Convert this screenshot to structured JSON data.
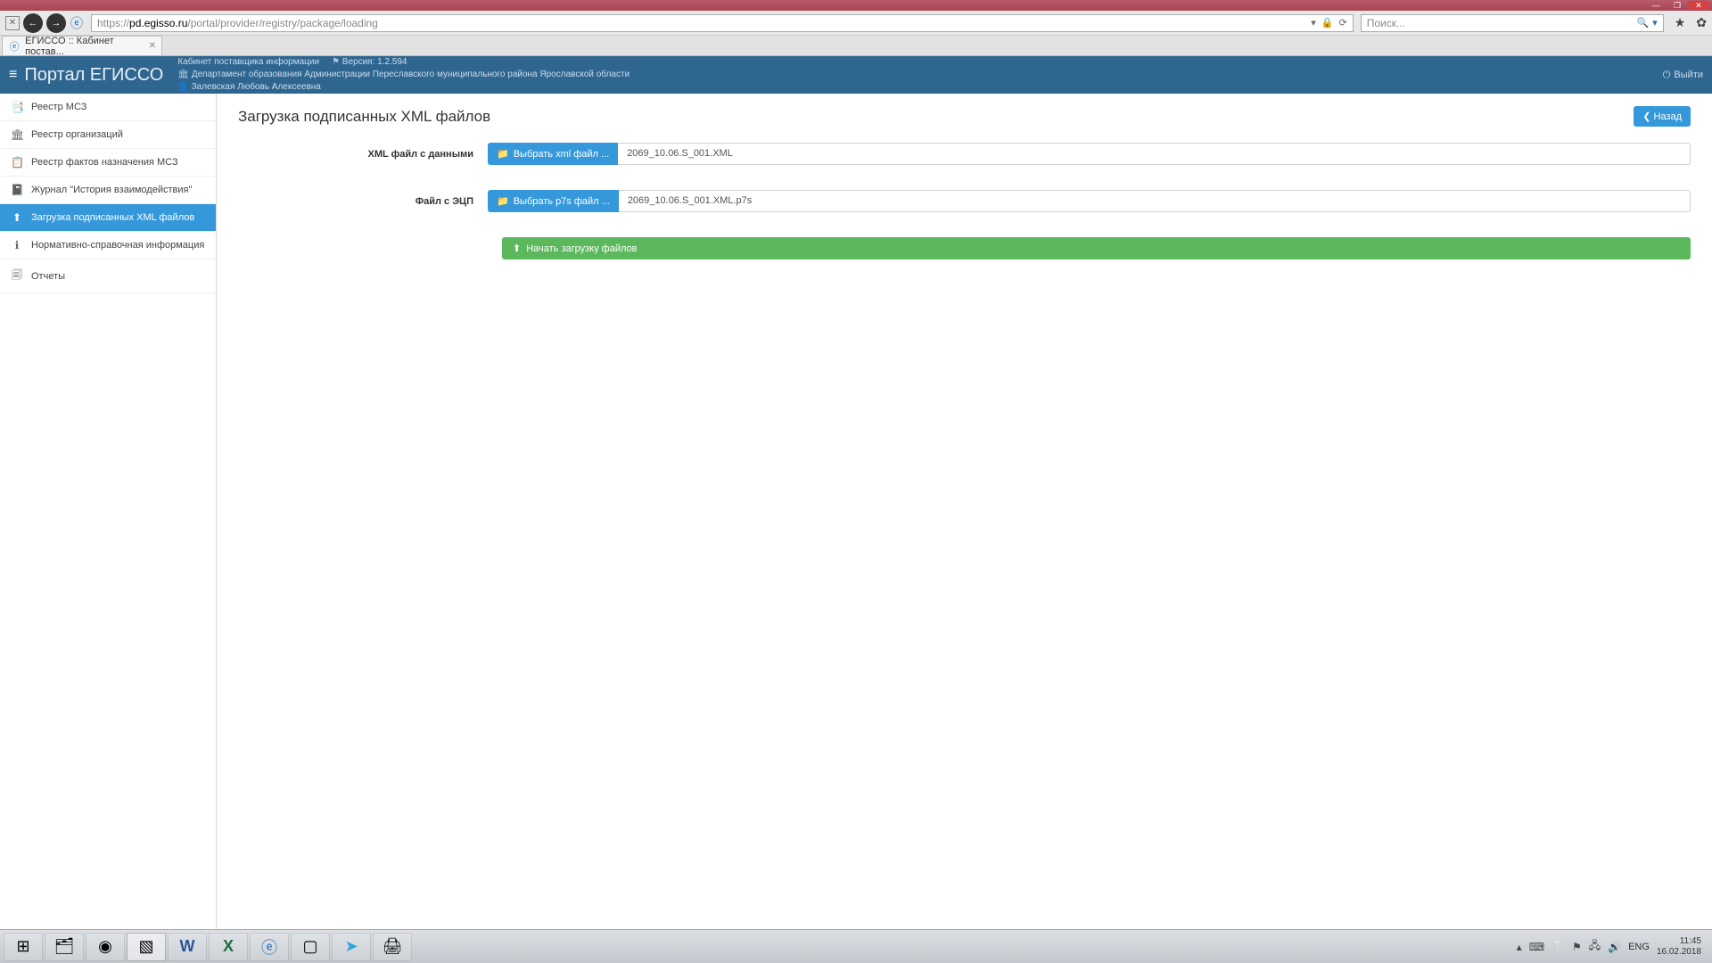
{
  "window": {
    "minimize": "—",
    "maximize": "❐",
    "close": "✕"
  },
  "browser": {
    "url_proto": "https://",
    "url_host": "pd.egisso.ru",
    "url_path": "/portal/provider/registry/package/loading",
    "search_placeholder": "Поиск...",
    "tab_title": "ЕГИССО :: Кабинет постав..."
  },
  "header": {
    "portal": "Портал ЕГИССО",
    "cabinet": "Кабинет поставщика информации",
    "version": "Версия: 1.2.594",
    "org": "Департамент образования Администрации Переславского муниципального района Ярославской области",
    "user": "Залевская Любовь Алексеевна",
    "logout": "Выйти"
  },
  "sidebar": {
    "items": [
      {
        "icon": "📑",
        "label": "Реестр МСЗ"
      },
      {
        "icon": "🏛",
        "label": "Реестр организаций"
      },
      {
        "icon": "📋",
        "label": "Реестр фактов назначения МСЗ"
      },
      {
        "icon": "📓",
        "label": "Журнал \"История взаимодействия\""
      },
      {
        "icon": "⬆",
        "label": "Загрузка подписанных XML файлов"
      },
      {
        "icon": "ℹ",
        "label": "Нормативно-справочная информация"
      },
      {
        "icon": "🗐",
        "label": "Отчеты"
      }
    ]
  },
  "page": {
    "title": "Загрузка подписанных XML файлов",
    "back": "Назад",
    "row1_label": "XML файл с данными",
    "row1_btn": "Выбрать xml файл ...",
    "row1_val": "2069_10.06.S_001.XML",
    "row2_label": "Файл с ЭЦП",
    "row2_btn": "Выбрать p7s файл ...",
    "row2_val": "2069_10.06.S_001.XML.p7s",
    "upload": "Начать загрузку файлов"
  },
  "taskbar": {
    "lang": "ENG",
    "time": "11:45",
    "date": "16.02.2018"
  }
}
